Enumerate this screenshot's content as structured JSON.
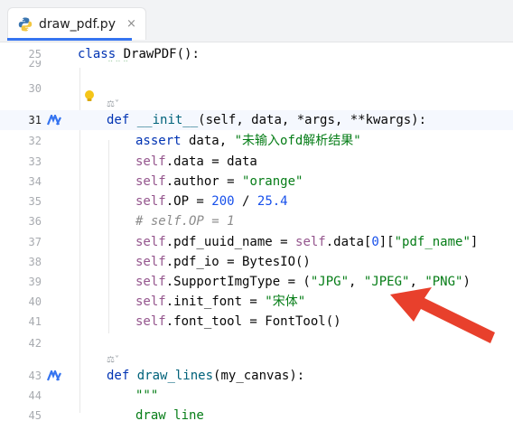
{
  "tab": {
    "filename": "draw_pdf.py",
    "close": "×"
  },
  "code": {
    "l25_num": "25",
    "l25_kw": "class",
    "l25_rest": " DrawPDF():",
    "l29_num": "29",
    "l29_text": "\"\"\"",
    "l30_num": "30",
    "l31_num": "31",
    "l31_kw": "def",
    "l31_fn": "__init__",
    "l31_rest": "(self, data, *args, **kwargs):",
    "l32_num": "32",
    "l32_kw": "assert",
    "l32_mid": " data, ",
    "l32_str": "\"未输入ofd解析结果\"",
    "l33_num": "33",
    "l33_self": "self",
    "l33_rest": ".data = data",
    "l34_num": "34",
    "l34_self": "self",
    "l34_mid": ".author = ",
    "l34_str": "\"orange\"",
    "l35_num": "35",
    "l35_self": "self",
    "l35_mid": ".OP = ",
    "l35_n1": "200",
    "l35_mid2": " / ",
    "l35_n2": "25.4",
    "l36_num": "36",
    "l36_cmt": "# self.OP = 1",
    "l37_num": "37",
    "l37_self": "self",
    "l37_mid": ".pdf_uuid_name = ",
    "l37_self2": "self",
    "l37_mid2": ".data[",
    "l37_n": "0",
    "l37_mid3": "][",
    "l37_str": "\"pdf_name\"",
    "l37_end": "]",
    "l38_num": "38",
    "l38_self": "self",
    "l38_rest": ".pdf_io = BytesIO()",
    "l39_num": "39",
    "l39_self": "self",
    "l39_mid": ".SupportImgType = (",
    "l39_s1": "\"JPG\"",
    "l39_c1": ", ",
    "l39_s2": "\"JPEG\"",
    "l39_c2": ", ",
    "l39_s3": "\"PNG\"",
    "l39_end": ")",
    "l40_num": "40",
    "l40_self": "self",
    "l40_mid": ".init_font = ",
    "l40_str": "\"宋体\"",
    "l41_num": "41",
    "l41_self": "self",
    "l41_rest": ".font_tool = FontTool()",
    "l42_num": "42",
    "l43_num": "43",
    "l43_kw": "def",
    "l43_fn": "draw_lines",
    "l43_rest": "(my_canvas):",
    "l44_num": "44",
    "l44_text": "\"\"\"",
    "l45_num": "45",
    "l45_text": "draw_line"
  },
  "hints": {
    "inlay1": "⚖︎˅",
    "inlay2": "⚖︎˅"
  },
  "colors": {
    "keyword": "#0033b3",
    "string": "#067d17",
    "number": "#1750eb",
    "self": "#94558d",
    "arrow": "#e8402c"
  }
}
